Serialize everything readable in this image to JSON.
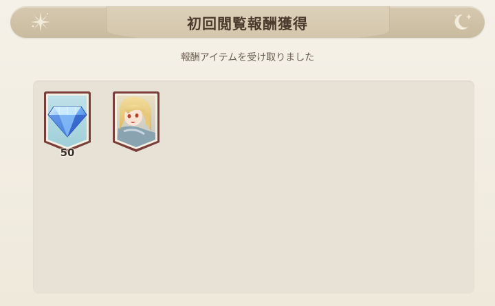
{
  "header": {
    "title": "初回閲覧報酬獲得"
  },
  "subtitle": "報酬アイテムを受け取りました",
  "rewards": [
    {
      "icon": "gem-icon",
      "quantity": "50"
    },
    {
      "icon": "character-portrait"
    }
  ],
  "colors": {
    "banner": "#d6c9b0",
    "panel": "#e8e2d6",
    "title_text": "#4a3b2c",
    "frame_border": "#7a3e3a"
  }
}
